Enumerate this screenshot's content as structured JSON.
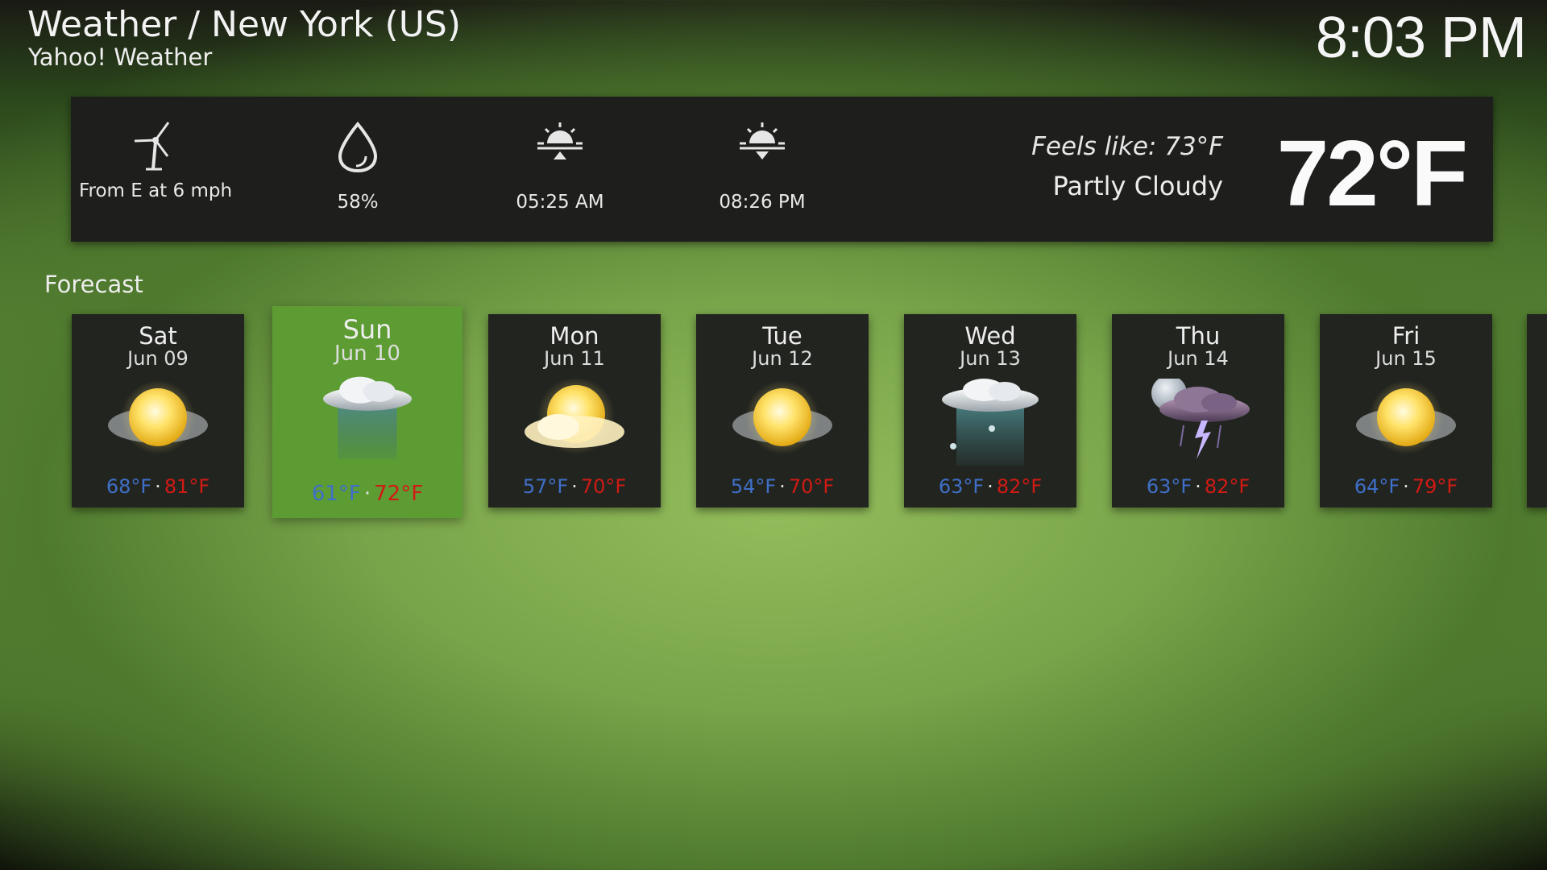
{
  "header": {
    "title": "Weather / New York (US)",
    "subtitle": "Yahoo! Weather",
    "time": "8:03 PM"
  },
  "current": {
    "wind": "From E at 6 mph",
    "humidity": "58%",
    "sunrise": "05:25 AM",
    "sunset": "08:26 PM",
    "feels_like": "Feels like: 73°F",
    "condition": "Partly Cloudy",
    "temperature": "72°F",
    "icons": [
      "wind-turbine-icon",
      "humidity-drop-icon",
      "sunrise-icon",
      "sunset-icon"
    ]
  },
  "forecast": {
    "label": "Forecast",
    "days": [
      {
        "day": "Sat",
        "date": "Jun 09",
        "low": "68°F",
        "high": "81°F",
        "icon": "sunny-icon"
      },
      {
        "day": "Sun",
        "date": "Jun 10",
        "low": "61°F",
        "high": "72°F",
        "icon": "rain-icon",
        "selected": true
      },
      {
        "day": "Mon",
        "date": "Jun 11",
        "low": "57°F",
        "high": "70°F",
        "icon": "partly-cloudy-icon"
      },
      {
        "day": "Tue",
        "date": "Jun 12",
        "low": "54°F",
        "high": "70°F",
        "icon": "sunny-icon"
      },
      {
        "day": "Wed",
        "date": "Jun 13",
        "low": "63°F",
        "high": "82°F",
        "icon": "rain-icon"
      },
      {
        "day": "Thu",
        "date": "Jun 14",
        "low": "63°F",
        "high": "82°F",
        "icon": "night-thunderstorm-icon"
      },
      {
        "day": "Fri",
        "date": "Jun 15",
        "low": "64°F",
        "high": "79°F",
        "icon": "sunny-icon"
      }
    ]
  },
  "colors": {
    "low_temp": "#3f6fc8",
    "high_temp": "#d11a14",
    "selected_card": "#5d9c33",
    "panel": "#1e1f1c",
    "card": "#22241f"
  }
}
